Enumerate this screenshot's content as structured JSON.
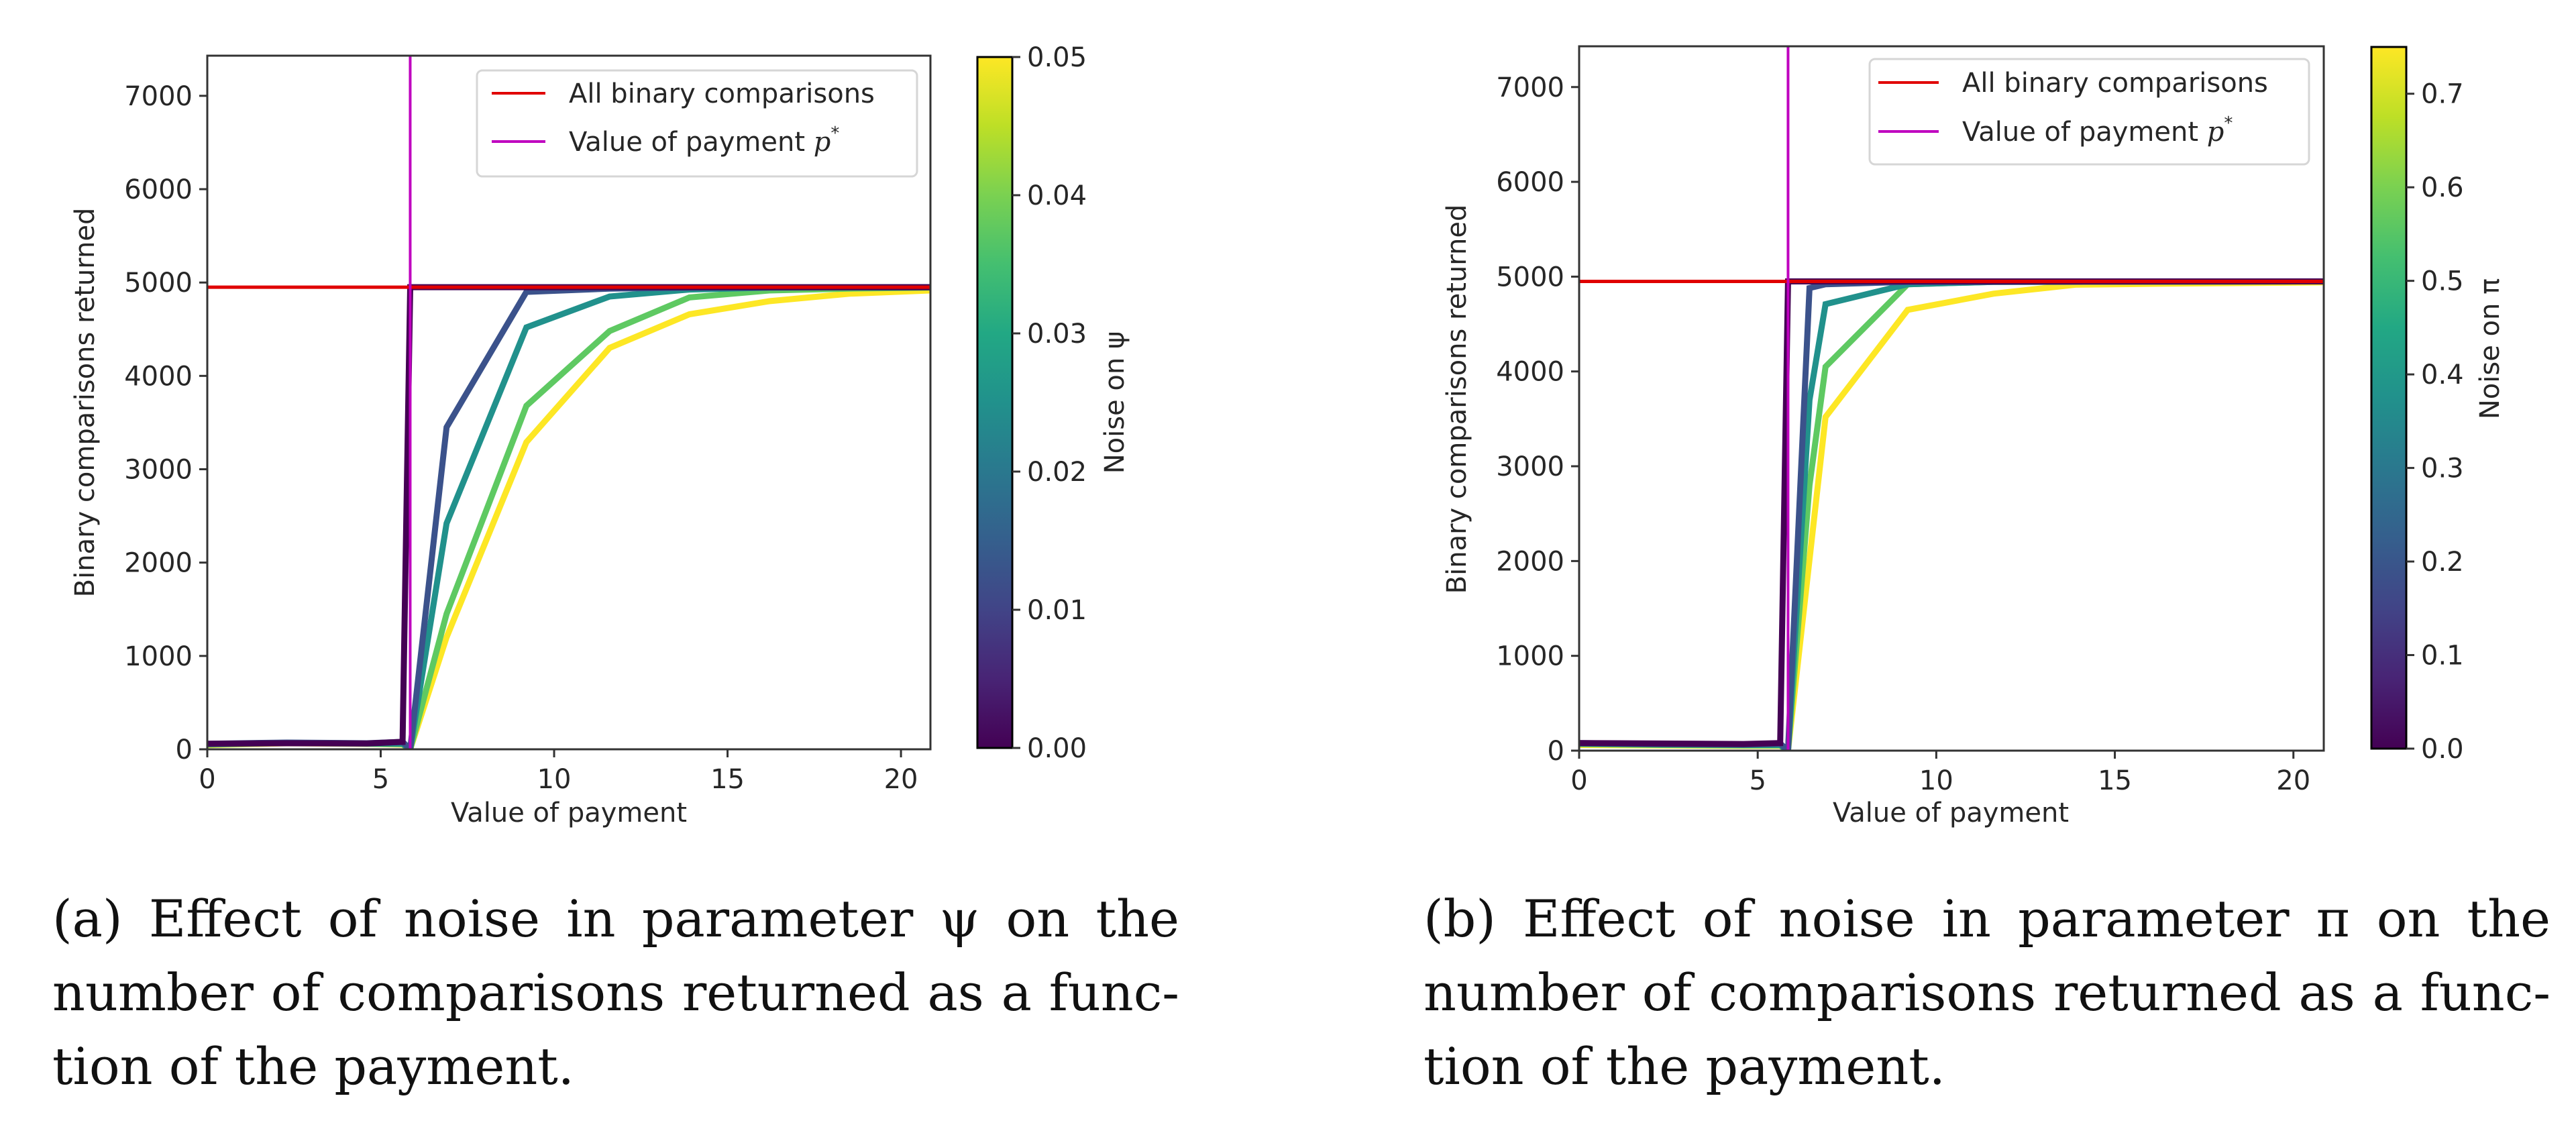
{
  "chart_data": [
    {
      "id": "a",
      "type": "line",
      "xlabel": "Value of payment",
      "ylabel": "Binary comparisons returned",
      "xlim": [
        0,
        20.85
      ],
      "ylim": [
        0,
        7430
      ],
      "xticks": [
        0,
        5,
        10,
        15,
        20
      ],
      "yticks": [
        0,
        1000,
        2000,
        3000,
        4000,
        5000,
        6000,
        7000
      ],
      "grid": false,
      "legend": {
        "position": "top-right",
        "entries": [
          {
            "label": "All binary comparisons",
            "color": "#e00000"
          },
          {
            "label": "Value of payment p*",
            "label_main": "Value of payment ",
            "label_var": "p",
            "label_sup": "*",
            "color": "#bf00bf"
          }
        ]
      },
      "reference_lines": {
        "all_binary_comparisons_y": 4950,
        "payment_p_star_x": 5.85
      },
      "colorbar": {
        "label": "Noise on ψ",
        "range": [
          0.0,
          0.05
        ],
        "ticks": [
          "0.00",
          "0.01",
          "0.02",
          "0.03",
          "0.04",
          "0.05"
        ],
        "tick_values": [
          0.0,
          0.01,
          0.02,
          0.03,
          0.04,
          0.05
        ],
        "colormap": "viridis"
      },
      "series": [
        {
          "name": "noise 0.00",
          "noise": 0.0,
          "color": "#440154",
          "points": [
            [
              0,
              60
            ],
            [
              2.3,
              65
            ],
            [
              4.6,
              62
            ],
            [
              5.63,
              80
            ],
            [
              5.85,
              4950
            ],
            [
              9.2,
              4950
            ],
            [
              20.85,
              4950
            ]
          ]
        },
        {
          "name": "noise 0.01",
          "noise": 0.01,
          "color": "#3b528b",
          "points": [
            [
              0,
              60
            ],
            [
              2.3,
              72
            ],
            [
              4.6,
              65
            ],
            [
              5.63,
              80
            ],
            [
              5.85,
              0
            ],
            [
              6.9,
              3450
            ],
            [
              9.2,
              4900
            ],
            [
              11.6,
              4935
            ],
            [
              13.9,
              4945
            ],
            [
              20.85,
              4950
            ]
          ]
        },
        {
          "name": "noise 0.03",
          "noise": 0.03,
          "color": "#21918c",
          "points": [
            [
              0,
              55
            ],
            [
              2.3,
              70
            ],
            [
              4.6,
              62
            ],
            [
              5.63,
              60
            ],
            [
              5.85,
              0
            ],
            [
              6.9,
              2420
            ],
            [
              9.2,
              4520
            ],
            [
              11.6,
              4850
            ],
            [
              13.9,
              4925
            ],
            [
              16.2,
              4945
            ],
            [
              20.85,
              4950
            ]
          ]
        },
        {
          "name": "noise 0.04",
          "noise": 0.04,
          "color": "#5ec962",
          "points": [
            [
              0,
              50
            ],
            [
              2.3,
              68
            ],
            [
              4.6,
              60
            ],
            [
              5.63,
              55
            ],
            [
              5.85,
              0
            ],
            [
              6.9,
              1450
            ],
            [
              9.2,
              3680
            ],
            [
              11.6,
              4480
            ],
            [
              13.9,
              4840
            ],
            [
              16.2,
              4915
            ],
            [
              18.5,
              4935
            ],
            [
              20.85,
              4945
            ]
          ]
        },
        {
          "name": "noise 0.05",
          "noise": 0.05,
          "color": "#fde725",
          "points": [
            [
              0,
              45
            ],
            [
              2.3,
              65
            ],
            [
              4.6,
              58
            ],
            [
              5.63,
              50
            ],
            [
              5.85,
              0
            ],
            [
              6.9,
              1200
            ],
            [
              9.2,
              3290
            ],
            [
              11.6,
              4300
            ],
            [
              13.9,
              4660
            ],
            [
              16.2,
              4800
            ],
            [
              18.5,
              4880
            ],
            [
              20.85,
              4915
            ]
          ]
        }
      ]
    },
    {
      "id": "b",
      "type": "line",
      "xlabel": "Value of payment",
      "ylabel": "Binary comparisons returned",
      "xlim": [
        0,
        20.85
      ],
      "ylim": [
        0,
        7430
      ],
      "xticks": [
        0,
        5,
        10,
        15,
        20
      ],
      "yticks": [
        0,
        1000,
        2000,
        3000,
        4000,
        5000,
        6000,
        7000
      ],
      "grid": false,
      "legend": {
        "position": "top-right",
        "entries": [
          {
            "label": "All binary comparisons",
            "color": "#e00000"
          },
          {
            "label": "Value of payment p*",
            "label_main": "Value of payment ",
            "label_var": "p",
            "label_sup": "*",
            "color": "#bf00bf"
          }
        ]
      },
      "reference_lines": {
        "all_binary_comparisons_y": 4950,
        "payment_p_star_x": 5.85
      },
      "colorbar": {
        "label": "Noise on π",
        "range": [
          0.0,
          0.75
        ],
        "ticks": [
          "0.0",
          "0.1",
          "0.2",
          "0.3",
          "0.4",
          "0.5",
          "0.6",
          "0.7"
        ],
        "tick_values": [
          0.0,
          0.1,
          0.2,
          0.3,
          0.4,
          0.5,
          0.6,
          0.7
        ],
        "colormap": "viridis"
      },
      "series": [
        {
          "name": "noise 0.0",
          "noise": 0.0,
          "color": "#440154",
          "points": [
            [
              0,
              80
            ],
            [
              2.3,
              75
            ],
            [
              4.6,
              70
            ],
            [
              5.63,
              80
            ],
            [
              5.85,
              4950
            ],
            [
              9.2,
              4950
            ],
            [
              20.85,
              4950
            ]
          ]
        },
        {
          "name": "noise 0.2",
          "noise": 0.2,
          "color": "#3b528b",
          "points": [
            [
              0,
              80
            ],
            [
              2.3,
              70
            ],
            [
              4.6,
              65
            ],
            [
              5.63,
              75
            ],
            [
              5.85,
              0
            ],
            [
              6.45,
              4880
            ],
            [
              6.9,
              4920
            ],
            [
              9.2,
              4945
            ],
            [
              20.85,
              4950
            ]
          ]
        },
        {
          "name": "noise 0.38",
          "noise": 0.38,
          "color": "#21918c",
          "points": [
            [
              0,
              75
            ],
            [
              2.3,
              65
            ],
            [
              4.6,
              60
            ],
            [
              5.63,
              60
            ],
            [
              5.85,
              0
            ],
            [
              6.45,
              3700
            ],
            [
              6.9,
              4710
            ],
            [
              9.2,
              4920
            ],
            [
              11.6,
              4945
            ],
            [
              20.85,
              4950
            ]
          ]
        },
        {
          "name": "noise 0.55",
          "noise": 0.55,
          "color": "#5ec962",
          "points": [
            [
              0,
              70
            ],
            [
              2.3,
              60
            ],
            [
              4.6,
              55
            ],
            [
              5.63,
              55
            ],
            [
              5.85,
              0
            ],
            [
              6.45,
              2800
            ],
            [
              6.9,
              4050
            ],
            [
              9.2,
              4920
            ],
            [
              11.6,
              4945
            ],
            [
              20.85,
              4950
            ]
          ]
        },
        {
          "name": "noise 0.75",
          "noise": 0.75,
          "color": "#fde725",
          "points": [
            [
              0,
              60
            ],
            [
              2.3,
              55
            ],
            [
              4.6,
              50
            ],
            [
              5.63,
              50
            ],
            [
              5.85,
              0
            ],
            [
              6.9,
              3520
            ],
            [
              9.2,
              4650
            ],
            [
              11.6,
              4820
            ],
            [
              13.9,
              4915
            ],
            [
              16.2,
              4925
            ],
            [
              20.85,
              4940
            ]
          ]
        }
      ]
    }
  ],
  "captions": {
    "a": {
      "lines": [
        "(a) Effect of noise in parameter ψ on the",
        "number of comparisons returned as a func-",
        "tion of the payment."
      ]
    },
    "b": {
      "lines": [
        "(b) Effect of noise in parameter π on the",
        "number of comparisons returned as a func-",
        "tion of the payment."
      ]
    }
  }
}
